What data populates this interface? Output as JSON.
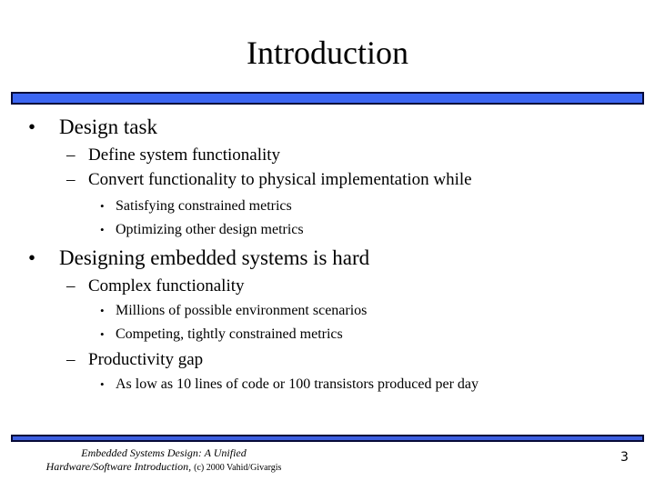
{
  "slide": {
    "title": "Introduction",
    "bullets": [
      {
        "text": "Design task",
        "sub": [
          {
            "text": "Define system functionality",
            "sub": []
          },
          {
            "text": "Convert functionality to physical implementation while",
            "sub": [
              "Satisfying constrained metrics",
              "Optimizing other design metrics"
            ]
          }
        ]
      },
      {
        "text": "Designing embedded systems is hard",
        "sub": [
          {
            "text": "Complex functionality",
            "sub": [
              "Millions of possible environment scenarios",
              "Competing, tightly constrained metrics"
            ]
          },
          {
            "text": "Productivity gap",
            "sub": [
              "As low as 10 lines of code or 100 transistors produced per day"
            ]
          }
        ]
      }
    ],
    "marks": {
      "level1": "•",
      "level2": "–",
      "level3": "•"
    },
    "footer": {
      "line1": "Embedded Systems Design: A Unified",
      "line2_italic": "Hardware/Software Introduction,",
      "line2_plain": "(c) 2000 Vahid/Givargis"
    },
    "page_number": "3",
    "colors": {
      "bar_fill": "#3c66f2",
      "bar_border": "#060a38"
    }
  }
}
